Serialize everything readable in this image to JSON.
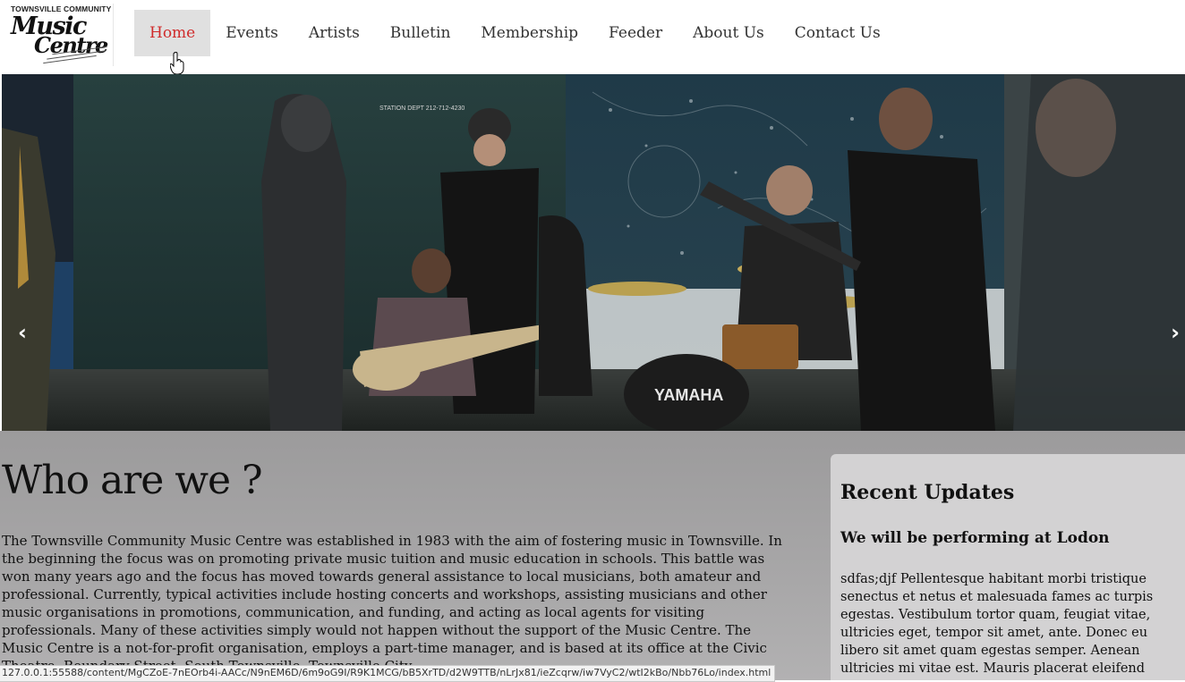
{
  "logo": {
    "top_line": "TOWNSVILLE COMMUNITY",
    "word1": "Music",
    "word2": "Centre"
  },
  "nav": {
    "items": [
      {
        "label": "Home",
        "active": true
      },
      {
        "label": "Events",
        "active": false
      },
      {
        "label": "Artists",
        "active": false
      },
      {
        "label": "Bulletin",
        "active": false
      },
      {
        "label": "Membership",
        "active": false
      },
      {
        "label": "Feeder",
        "active": false
      },
      {
        "label": "About Us",
        "active": false
      },
      {
        "label": "Contact Us",
        "active": false
      }
    ],
    "active_color": "#d02b2b"
  },
  "carousel": {
    "prev_label": "‹",
    "next_label": "›",
    "image_text": {
      "sign": "STATION DEPT 212-712-4230",
      "drum_brand": "YAMAHA"
    }
  },
  "main": {
    "heading": "Who are we ?",
    "body": "The Townsville Community Music Centre was established in 1983 with the aim of fostering music in Townsville. In the beginning the focus was on promoting private music tuition and music education in schools. This battle was won many years ago and the focus has moved towards general assistance to local musicians, both amateur and professional. Currently, typical activities include hosting concerts and workshops, assisting musicians and other music organisations in promotions, communication, and funding, and acting as local agents for visiting professionals. Many of these activities simply would not happen without the support of the Music Centre. The Music Centre is a not-for-profit organisation, employs a part-time manager, and is based at its office at the Civic Theatre, Boundary Street, South Townsville, Townsville City."
  },
  "sidebar": {
    "title": "Recent Updates",
    "update_title": "We will be performing at Lodon",
    "update_body": "sdfas;djf Pellentesque habitant morbi tristique senectus et netus et malesuada fames ac turpis egestas. Vestibulum tortor quam, feugiat vitae, ultricies eget, tempor sit amet, ante. Donec eu libero sit amet quam egestas semper. Aenean ultricies mi vitae est. Mauris placerat eleifend"
  },
  "statusbar": {
    "url": "127.0.0.1:55588/content/MgCZoE-7nEOrb4i-AACc/N9nEM6D/6m9oG9I/R9K1MCG/bB5XrTD/d2W9TTB/nLrJx81/ieZcqrw/iw7VyC2/wtI2kBo/Nbb76Lo/index.html"
  }
}
